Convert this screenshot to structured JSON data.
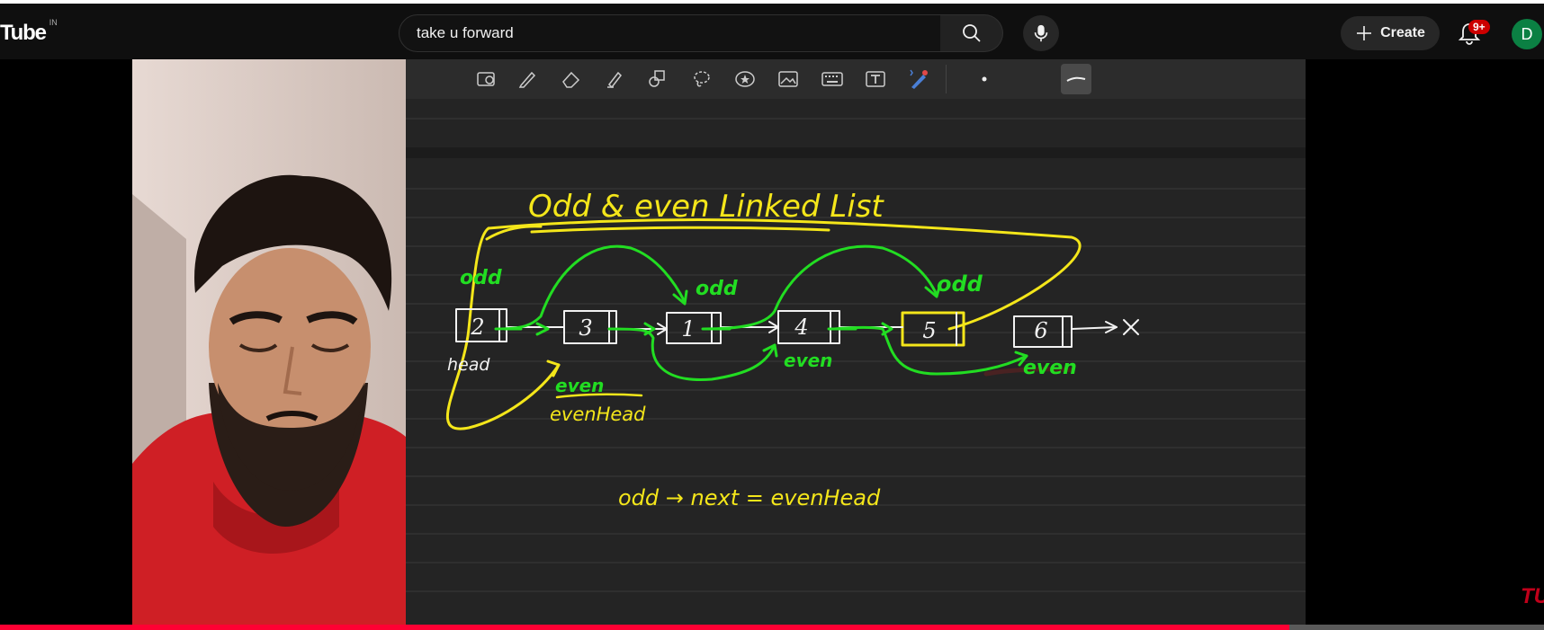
{
  "header": {
    "logo_text": "Tube",
    "logo_region": "IN",
    "search": {
      "value": "take u forward",
      "placeholder": "Search"
    },
    "create_label": "Create",
    "notifications_badge": "9+",
    "avatar_letter": "D"
  },
  "whiteboard": {
    "title": "Odd & even Linked List",
    "nodes": [
      "2",
      "3",
      "1",
      "4",
      "5",
      "6"
    ],
    "end_marker": "X",
    "labels": {
      "head": "head",
      "odd_1": "odd",
      "odd_2": "odd",
      "odd_3": "odd",
      "even_1": "even",
      "even_2": "even",
      "even_3": "even",
      "even_head": "evenHead"
    },
    "equation": "odd → next = evenHead"
  },
  "watermark": "TU",
  "player": {
    "progress_fraction": 0.835
  },
  "colors": {
    "brand_red": "#ff0033",
    "ink_yellow": "#f4e61a",
    "ink_green": "#22dd22",
    "ink_white": "#f2f2f2",
    "board_bg": "#242424"
  }
}
